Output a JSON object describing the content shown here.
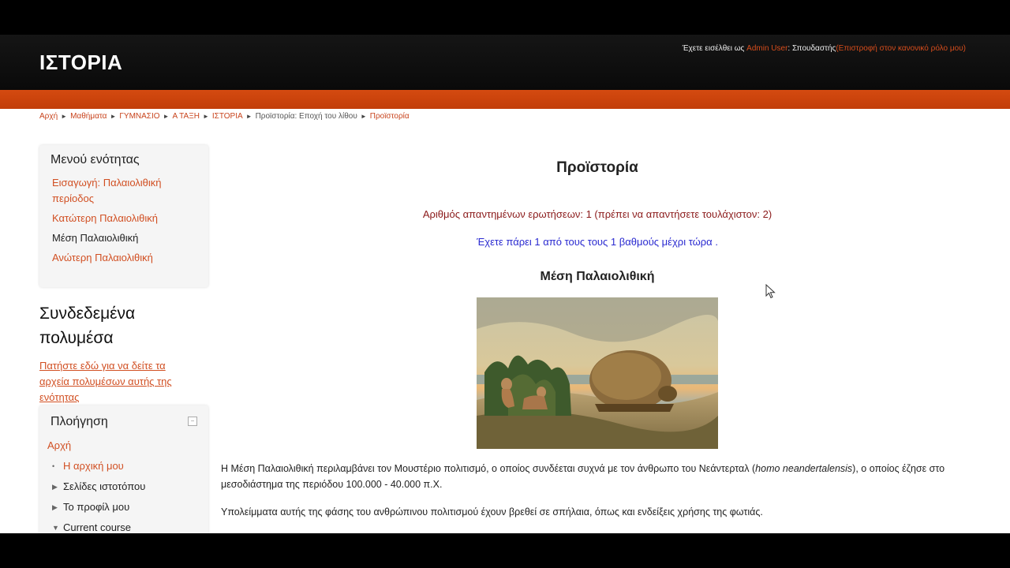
{
  "header": {
    "site_title": "ΙΣΤΟΡΙΑ",
    "login_prefix": "Έχετε εισέλθει ως",
    "user_name": "Admin User",
    "role_text": ": Σπουδαστής",
    "return_role": "(Επιστροφή στον κανονικό ρόλο μου)"
  },
  "breadcrumb": {
    "items": [
      "Αρχή",
      "Μαθήματα",
      "ΓΥΜΝΑΣΙΟ",
      "Α ΤΑΞΗ",
      "ΙΣΤΟΡΙΑ",
      "Προϊστορία: Εποχή του λίθου",
      "Προϊστορία"
    ]
  },
  "section_menu": {
    "title": "Μενού ενότητας",
    "items": [
      {
        "label": "Εισαγωγή: Παλαιολιθική περίοδος"
      },
      {
        "label": "Κατώτερη Παλαιολιθική"
      },
      {
        "label": "Μέση Παλαιολιθική"
      },
      {
        "label": "Ανώτερη Παλαιολιθική"
      }
    ]
  },
  "media": {
    "title": "Συνδεδεμένα πολυμέσα",
    "link": "Πατήστε εδώ για να δείτε τα αρχεία πολυμέσων αυτής της ενότητας"
  },
  "navigation": {
    "title": "Πλοήγηση",
    "home": "Αρχή",
    "my_home": "Η αρχική μου",
    "site_pages": "Σελίδες ιστοτόπου",
    "my_profile": "Το προφίλ μου",
    "current_course": "Current course"
  },
  "main": {
    "heading": "Προϊστορία",
    "answered": "Αριθμός απαντημένων ερωτήσεων: 1 (πρέπει να απαντήσετε τουλάχιστον: 2)",
    "grade": "Έχετε πάρει 1 από τους τους 1 βαθμούς μέχρι τώρα .",
    "sub_heading": "Μέση Παλαιολιθική",
    "para1_a": "Η Μέση Παλαιολιθική περιλαμβάνει τον Μουστέριο πολιτισμό, ο οποίος συνδέεται συχνά με τον άνθρωπο του Νεάντερταλ (",
    "para1_italic": "homo neandertalensis",
    "para1_b": "), ο οποίος έζησε στο μεσοδιάστημα της περιόδου 100.000 - 40.000 π.Χ.",
    "para2": "Υπολείμματα αυτής της φάσης του ανθρώπινου πολιτισμού έχουν βρεθεί σε σπήλαια, όπως και ενδείξεις χρήσης της φωτιάς."
  },
  "colors": {
    "accent_orange": "#d14f22",
    "header_bg": "#0f0f0f",
    "answered_color": "#8b1a1a",
    "grade_color": "#2a2ad0"
  }
}
